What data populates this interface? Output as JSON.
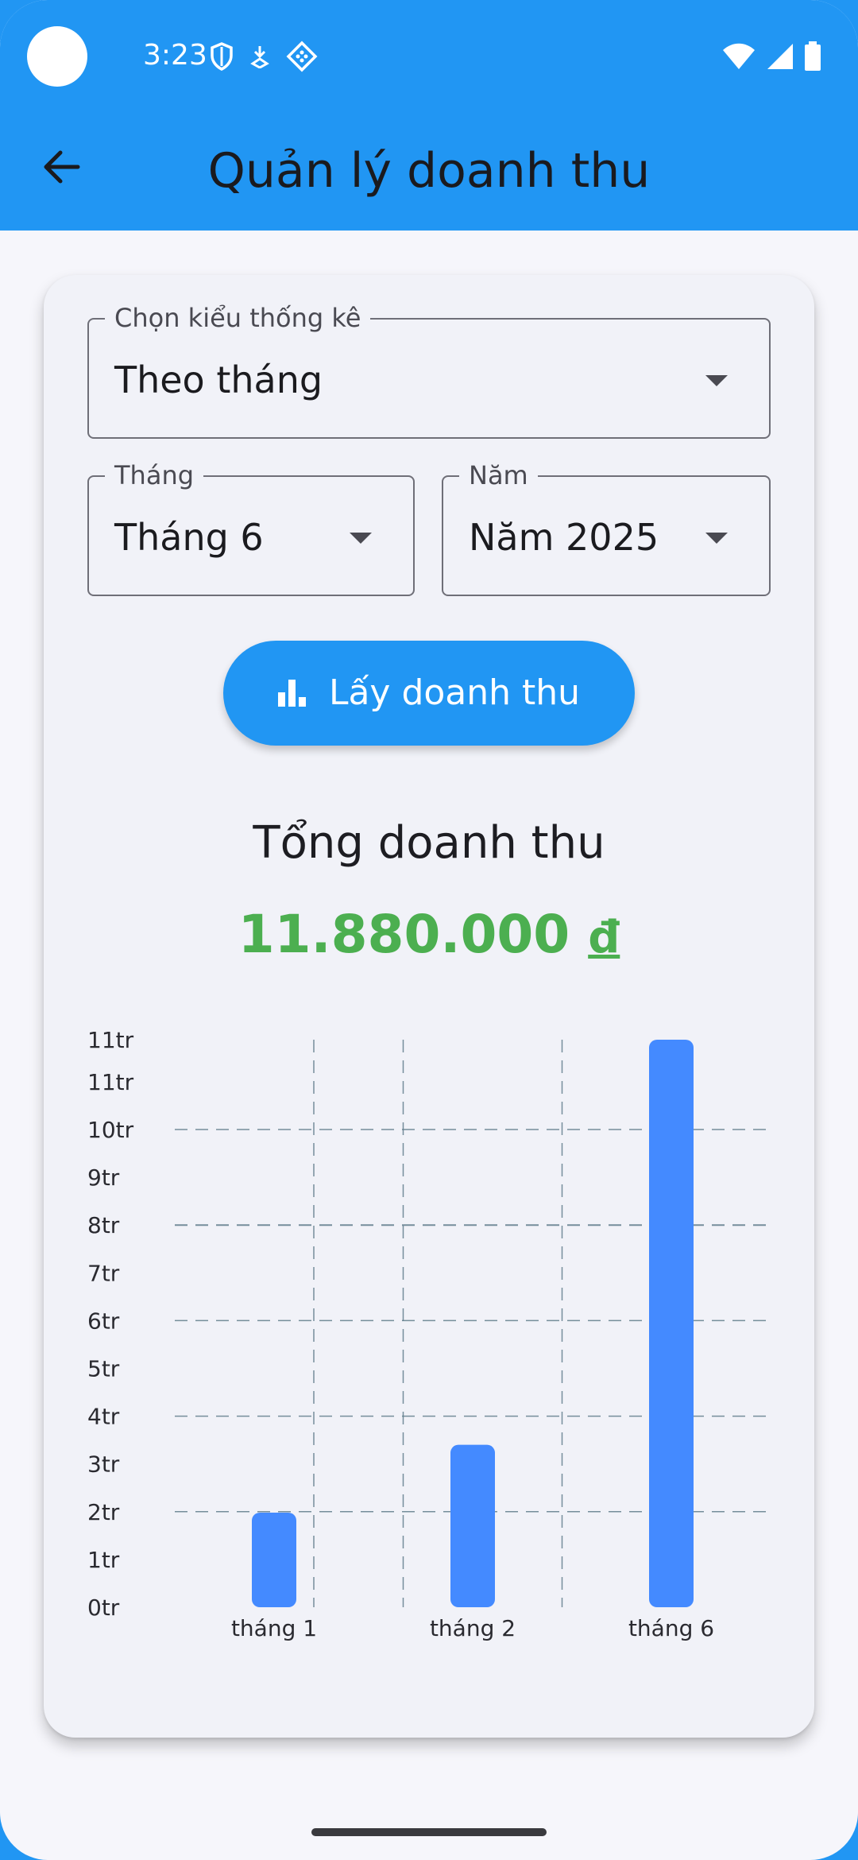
{
  "status_bar": {
    "time": "3:23",
    "left_icons": [
      "shield-icon",
      "download-icon",
      "diamond-icon"
    ],
    "right_icons": [
      "wifi-icon",
      "signal-icon",
      "battery-icon"
    ]
  },
  "app_bar": {
    "title": "Quản lý doanh thu",
    "back_icon": "arrow-back-icon"
  },
  "filters": {
    "type": {
      "label": "Chọn kiểu thống kê",
      "value": "Theo tháng"
    },
    "month": {
      "label": "Tháng",
      "value": "Tháng 6"
    },
    "year": {
      "label": "Năm",
      "value": "Năm 2025"
    }
  },
  "action_button": {
    "label": "Lấy doanh thu",
    "icon": "bar-chart-icon"
  },
  "summary": {
    "label": "Tổng doanh thu",
    "amount": "11.880.000",
    "currency": "đ"
  },
  "colors": {
    "primary": "#2196F3",
    "bar": "#448AFF",
    "total": "#4CAF50",
    "grid": "#607D8B"
  },
  "chart_data": {
    "type": "bar",
    "categories": [
      "tháng 1",
      "tháng 2",
      "tháng 6"
    ],
    "values": [
      1.98,
      3.4,
      11.88
    ],
    "y_unit": "tr",
    "y_ticks": [
      "0tr",
      "1tr",
      "2tr",
      "3tr",
      "4tr",
      "5tr",
      "6tr",
      "7tr",
      "8tr",
      "9tr",
      "10tr",
      "11tr",
      "11tr"
    ],
    "y_tick_values": [
      0,
      1,
      2,
      3,
      4,
      5,
      6,
      7,
      8,
      9,
      10,
      11,
      11.88
    ],
    "ylim": [
      0,
      11.88
    ],
    "grid": true,
    "horizontal_grid_values": [
      2,
      4,
      6,
      8,
      10
    ],
    "vertical_grid_between_bars": true
  }
}
